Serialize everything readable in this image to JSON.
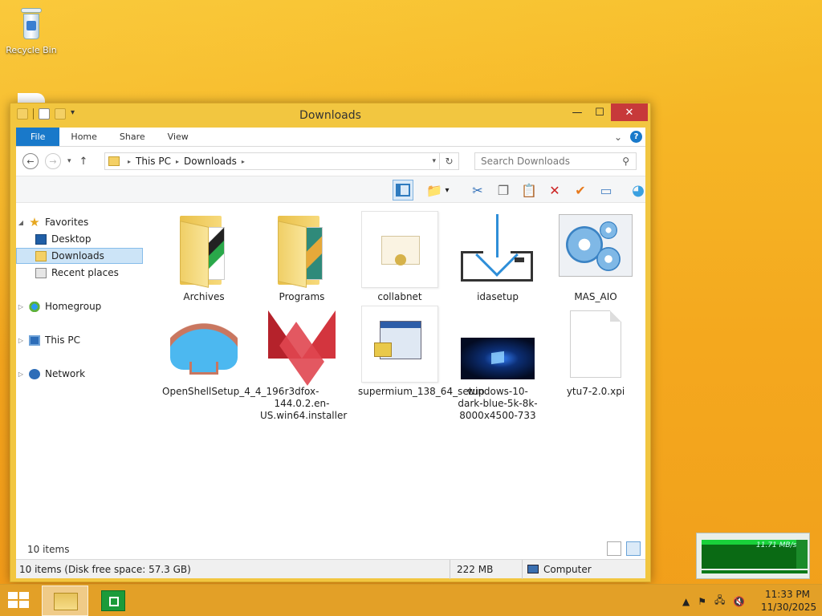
{
  "desktop": {
    "icons": [
      {
        "label": "Recycle Bin",
        "icon": "recycle-bin-icon"
      }
    ]
  },
  "window": {
    "title": "Downloads",
    "controls": {
      "minimize": "—",
      "maximize": "☐",
      "close": "✕"
    },
    "ribbon_tabs": [
      "File",
      "Home",
      "Share",
      "View"
    ],
    "ribbon_expand": "⌄",
    "help": "?",
    "nav": {
      "back": "←",
      "forward": "→",
      "recent": "▾",
      "up": "↑"
    },
    "address": {
      "crumbs": [
        "This PC",
        "Downloads"
      ],
      "separator": "▸",
      "dropdown": "▾",
      "refresh": "↻"
    },
    "search": {
      "placeholder": "Search Downloads",
      "icon": "⚲"
    },
    "toolbar": {
      "buttons": [
        {
          "name": "layout-pane-icon",
          "glyph": ""
        },
        {
          "name": "new-folder-icon",
          "glyph": "📁"
        },
        {
          "name": "dropdown-icon",
          "glyph": "▾"
        },
        {
          "name": "cut-icon",
          "glyph": "✂"
        },
        {
          "name": "copy-icon",
          "glyph": "❐"
        },
        {
          "name": "paste-icon",
          "glyph": "📋"
        },
        {
          "name": "delete-icon",
          "glyph": "✕"
        },
        {
          "name": "checkmark-icon",
          "glyph": "✔"
        },
        {
          "name": "rename-icon",
          "glyph": "▭"
        },
        {
          "name": "shell-icon",
          "glyph": "◕"
        }
      ]
    },
    "navpane": {
      "items": [
        {
          "label": "Favorites",
          "icon": "star-icon",
          "arrow": "◢"
        },
        {
          "label": "Desktop",
          "icon": "desktop-icon",
          "arrow": ""
        },
        {
          "label": "Downloads",
          "icon": "downloads-folder-icon",
          "arrow": "",
          "selected": true
        },
        {
          "label": "Recent places",
          "icon": "recent-places-icon",
          "arrow": ""
        },
        {
          "label": "Homegroup",
          "icon": "homegroup-icon",
          "arrow": "▷"
        },
        {
          "label": "This PC",
          "icon": "this-pc-icon",
          "arrow": "▷"
        },
        {
          "label": "Network",
          "icon": "network-icon",
          "arrow": "▷"
        }
      ]
    },
    "files": [
      {
        "name": "Archives",
        "icon": "folder-icon"
      },
      {
        "name": "Programs",
        "icon": "folder-icon"
      },
      {
        "name": "collabnet",
        "icon": "certificate-icon"
      },
      {
        "name": "idasetup",
        "icon": "download-installer-icon"
      },
      {
        "name": "MAS_AIO",
        "icon": "settings-gears-icon"
      },
      {
        "name": "OpenShellSetup_4_4_196",
        "icon": "shell-icon"
      },
      {
        "name": "r3dfox-144.0.2.en-US.win64.installer",
        "icon": "red-fox-icon"
      },
      {
        "name": "supermium_138_64_setup",
        "icon": "setup-app-icon"
      },
      {
        "name": "windows-10-dark-blue-5k-8k-8000x4500-733",
        "icon": "wallpaper-thumbnail-icon"
      },
      {
        "name": "ytu7-2.0.xpi",
        "icon": "blank-file-icon"
      }
    ],
    "item_count": "10 items",
    "status": {
      "left": "10 items (Disk free space: 57.3 GB)",
      "size": "222 MB",
      "location": "Computer"
    }
  },
  "netmeter": {
    "rate": "11.71 MB/s"
  },
  "taskbar": {
    "clock_time": "11:33 PM",
    "clock_date": "11/30/2025",
    "tray": [
      "▲",
      "⚑",
      "🖧",
      "🔇"
    ]
  }
}
